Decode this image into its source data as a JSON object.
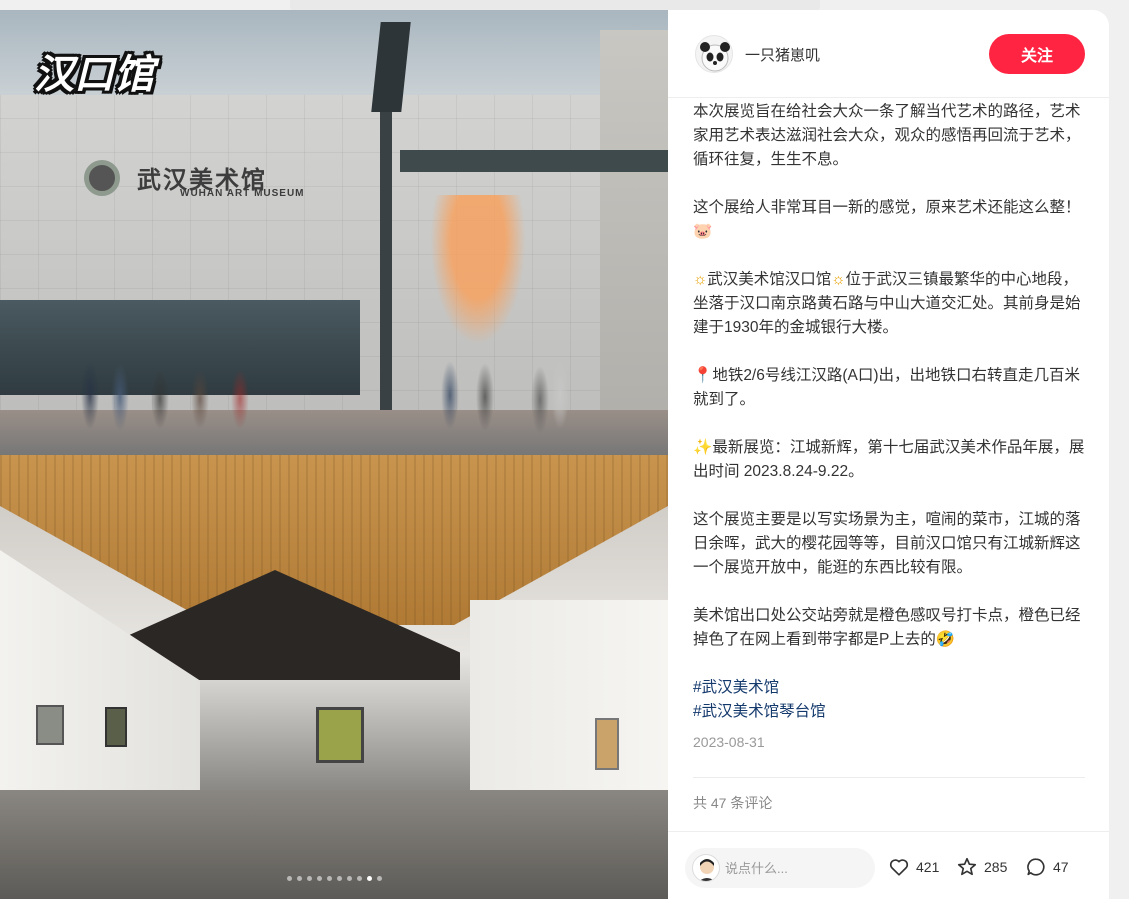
{
  "media": {
    "overlay_title": "汉口馆",
    "museum_sign_cn": "武汉美术馆",
    "museum_sign_en": "WUHAN ART MUSEUM",
    "slide_count": 10,
    "active_slide": 9
  },
  "author": {
    "name": "一只猪崽叽",
    "avatar_icon": "panda-avatar-icon",
    "follow_label": "关注",
    "follow_color": "#ff2442"
  },
  "post": {
    "paragraphs": [
      "本次展览旨在给社会大众一条了解当代艺术的路径，艺术家用艺术表达滋润社会大众，观众的感悟再回流于艺术，循环往复，生生不息。",
      "这个展给人非常耳目一新的感觉，原来艺术还能这么整！",
      "位于武汉三镇最繁华的中心地段，坐落于汉口南京路黄石路与中山大道交汇处。其前身是始建于1930年的金城银行大楼。",
      "地铁2/6号线江汉路(A口)出，出地铁口右转直走几百米就到了。",
      "最新展览：江城新辉，第十七届武汉美术作品年展，展出时间 2023.8.24-9.22。",
      "这个展览主要是以写实场景为主，喧闹的菜市，江城的落日余晖，武大的樱花园等等，目前汉口馆只有江城新辉这一个展览开放中，能逛的东西比较有限。",
      "美术馆出口处公交站旁就是橙色感叹号打卡点，橙色已经掉色了在网上看到带字都是P上去的"
    ],
    "highlight_name": "武汉美术馆汉口馆",
    "tags": [
      "#武汉美术馆",
      "#武汉美术馆琴台馆"
    ],
    "date": "2023-08-31",
    "comment_count_label": "共 47 条评论",
    "tag_color": "#13386c"
  },
  "bottom_bar": {
    "comment_placeholder": "说点什么...",
    "likes": "421",
    "collects": "285",
    "comments": "47"
  }
}
